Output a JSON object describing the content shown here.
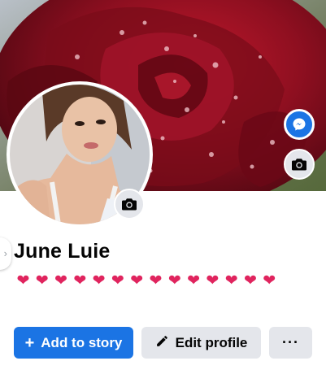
{
  "profile": {
    "name": "June Luie",
    "bio": "❤️❤️❤️❤️❤️❤️❤️❤️❤️❤️❤️❤️❤️❤️",
    "bio_hearts": 14
  },
  "actions": {
    "add_story_label": "Add to story",
    "add_story_icon": "+",
    "edit_profile_label": "Edit profile",
    "more_label": "···"
  },
  "icons": {
    "message": "messenger-icon",
    "camera": "camera-icon",
    "edit": "pencil-icon",
    "chevron": "chevron-right-icon"
  },
  "colors": {
    "primary": "#1b74e4",
    "secondary": "#e4e6eb",
    "text": "#050505"
  }
}
